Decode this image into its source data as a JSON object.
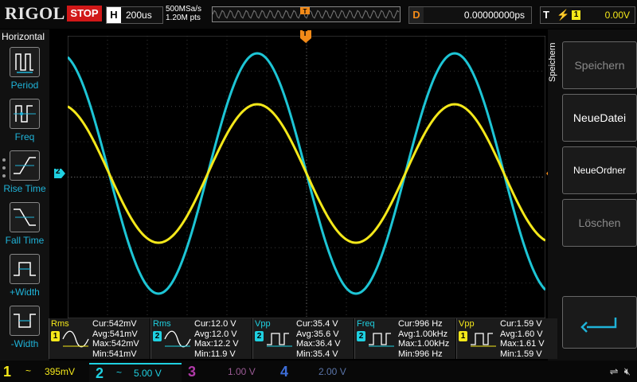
{
  "brand": "RIGOL",
  "run_state": "STOP",
  "horizontal": {
    "label": "H",
    "timebase": "200us"
  },
  "sampling": {
    "rate": "500MSa/s",
    "points": "1.20M pts"
  },
  "delay": {
    "label": "D",
    "value": "0.00000000ps"
  },
  "trigger": {
    "label": "T",
    "slope": "rising-edge-icon",
    "source": "1",
    "level": "0.00V"
  },
  "markers": {
    "trigger_pos": "T",
    "ch2_ground": "2",
    "trigger_level": "T"
  },
  "left_menu": {
    "title": "Horizontal",
    "items": [
      {
        "name": "period",
        "label": "Period"
      },
      {
        "name": "freq",
        "label": "Freq"
      },
      {
        "name": "rise-time",
        "label": "Rise Time"
      },
      {
        "name": "fall-time",
        "label": "Fall Time"
      },
      {
        "name": "plus-width",
        "label": "+Width"
      },
      {
        "name": "minus-width",
        "label": "-Width"
      }
    ]
  },
  "right_menu": {
    "tab": "Speichern",
    "buttons": [
      {
        "label": "Speichern",
        "enabled": false
      },
      {
        "label": "NeueDatei",
        "enabled": true
      },
      {
        "label": "NeueOrdner",
        "enabled": true
      },
      {
        "label": "Löschen",
        "enabled": false
      }
    ],
    "enter_icon": "return-arrow-icon"
  },
  "measurements": [
    {
      "name": "Rms",
      "channel": "1",
      "color": "#f4e81a",
      "icon": "sine-icon",
      "cur": "Cur:542mV",
      "avg": "Avg:541mV",
      "max": "Max:542mV",
      "min": "Min:541mV"
    },
    {
      "name": "Rms",
      "channel": "2",
      "color": "#1fd0e0",
      "icon": "sine-icon",
      "cur": "Cur:12.0 V",
      "avg": "Avg:12.0 V",
      "max": "Max:12.2 V",
      "min": "Min:11.9 V"
    },
    {
      "name": "Vpp",
      "channel": "2",
      "color": "#1fd0e0",
      "icon": "pulse-icon",
      "cur": "Cur:35.4 V",
      "avg": "Avg:35.6 V",
      "max": "Max:36.4 V",
      "min": "Min:35.4 V"
    },
    {
      "name": "Freq",
      "channel": "2",
      "color": "#1fd0e0",
      "icon": "pulse-icon",
      "cur": "Cur:996 Hz",
      "avg": "Avg:1.00kHz",
      "max": "Max:1.00kHz",
      "min": "Min:996 Hz"
    },
    {
      "name": "Vpp",
      "channel": "1",
      "color": "#f4e81a",
      "icon": "pulse-icon",
      "cur": "Cur:1.59 V",
      "avg": "Avg:1.60 V",
      "max": "Max:1.61 V",
      "min": "Min:1.59 V"
    }
  ],
  "channels": [
    {
      "num": "1",
      "coupling": "~",
      "scale": "395mV",
      "color": "#f4e81a",
      "active": true
    },
    {
      "num": "2",
      "coupling": "~",
      "scale": "5.00 V",
      "color": "#1fd0e0",
      "active": true
    },
    {
      "num": "3",
      "coupling": "",
      "scale": "1.00 V",
      "color": "#b03aa8",
      "active": false
    },
    {
      "num": "4",
      "coupling": "",
      "scale": "2.00 V",
      "color": "#3d6dd8",
      "active": false
    }
  ],
  "status_icons": [
    "usb-icon",
    "mute-icon"
  ],
  "colors": {
    "ch1": "#f4e81a",
    "ch2": "#1fd0e0",
    "accent": "#f28a18",
    "stop": "#d11818"
  }
}
